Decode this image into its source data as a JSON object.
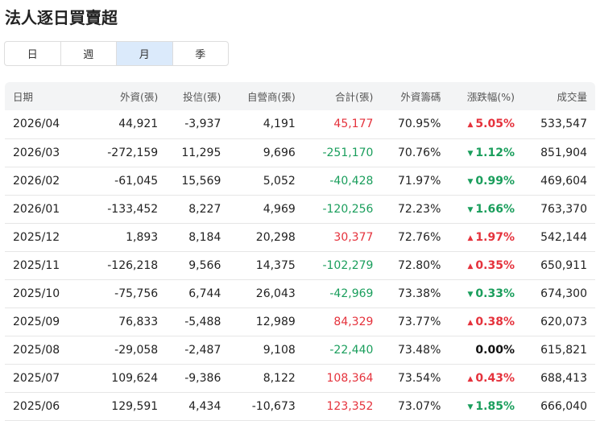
{
  "title": "法人逐日買賣超",
  "tabs": [
    {
      "label": "日"
    },
    {
      "label": "週"
    },
    {
      "label": "月",
      "active": true
    },
    {
      "label": "季"
    }
  ],
  "colors": {
    "up": "#e5323c",
    "down": "#1a9e5c",
    "active_tab": "#dbeafb"
  },
  "headers": [
    "日期",
    "外資(張)",
    "投信(張)",
    "自營商(張)",
    "合計(張)",
    "外資籌碼",
    "漲跌幅(%)",
    "成交量"
  ],
  "rows": [
    [
      "2026/04",
      "44,921",
      "-3,937",
      "4,191",
      "45,177",
      "70.95%",
      "5.05%",
      "533,547",
      "up"
    ],
    [
      "2026/03",
      "-272,159",
      "11,295",
      "9,696",
      "-251,170",
      "70.76%",
      "1.12%",
      "851,904",
      "down"
    ],
    [
      "2026/02",
      "-61,045",
      "15,569",
      "5,052",
      "-40,428",
      "71.97%",
      "0.99%",
      "469,604",
      "down"
    ],
    [
      "2026/01",
      "-133,452",
      "8,227",
      "4,969",
      "-120,256",
      "72.23%",
      "1.66%",
      "763,370",
      "down"
    ],
    [
      "2025/12",
      "1,893",
      "8,184",
      "20,298",
      "30,377",
      "72.76%",
      "1.97%",
      "542,144",
      "up"
    ],
    [
      "2025/11",
      "-126,218",
      "9,566",
      "14,375",
      "-102,279",
      "72.80%",
      "0.35%",
      "650,911",
      "up"
    ],
    [
      "2025/10",
      "-75,756",
      "6,744",
      "26,043",
      "-42,969",
      "73.38%",
      "0.33%",
      "674,300",
      "down"
    ],
    [
      "2025/09",
      "76,833",
      "-5,488",
      "12,989",
      "84,329",
      "73.77%",
      "0.38%",
      "620,073",
      "up"
    ],
    [
      "2025/08",
      "-29,058",
      "-2,487",
      "9,108",
      "-22,440",
      "73.48%",
      "0.00%",
      "615,821",
      "flat"
    ],
    [
      "2025/07",
      "109,624",
      "-9,386",
      "8,122",
      "108,364",
      "73.54%",
      "0.43%",
      "688,413",
      "up"
    ],
    [
      "2025/06",
      "129,591",
      "4,434",
      "-10,673",
      "123,352",
      "73.07%",
      "1.85%",
      "666,040",
      "down"
    ]
  ]
}
